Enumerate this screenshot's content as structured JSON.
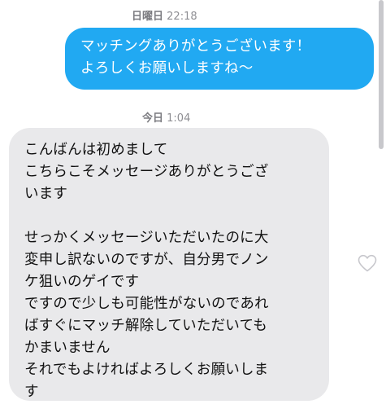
{
  "conversation": {
    "timestamp_1": {
      "day": "日曜日",
      "time": "22:18"
    },
    "sent_message": {
      "lines": [
        "マッチングありがとうございます！",
        "よろしくお願いしますね〜"
      ]
    },
    "timestamp_2": {
      "day": "今日",
      "time": "1:04"
    },
    "received_message": {
      "lines": [
        "こんばんは初めまして",
        "こちらこそメッセージありがとうござ",
        "います",
        "",
        "せっかくメッセージいただいたのに大",
        "変申し訳ないのですが、自分男でノン",
        "ケ狙いのゲイです",
        "ですので少しも可能性がないのであれ",
        "ばすぐにマッチ解除していただいても",
        "かまいません",
        "それでもよければよろしくお願いしま",
        "す"
      ]
    },
    "like_icon": "heart-outline-icon"
  },
  "colors": {
    "sent_bubble": "#21a9f2",
    "received_bubble": "#e9e9eb",
    "timestamp_text": "#8e8e93"
  }
}
